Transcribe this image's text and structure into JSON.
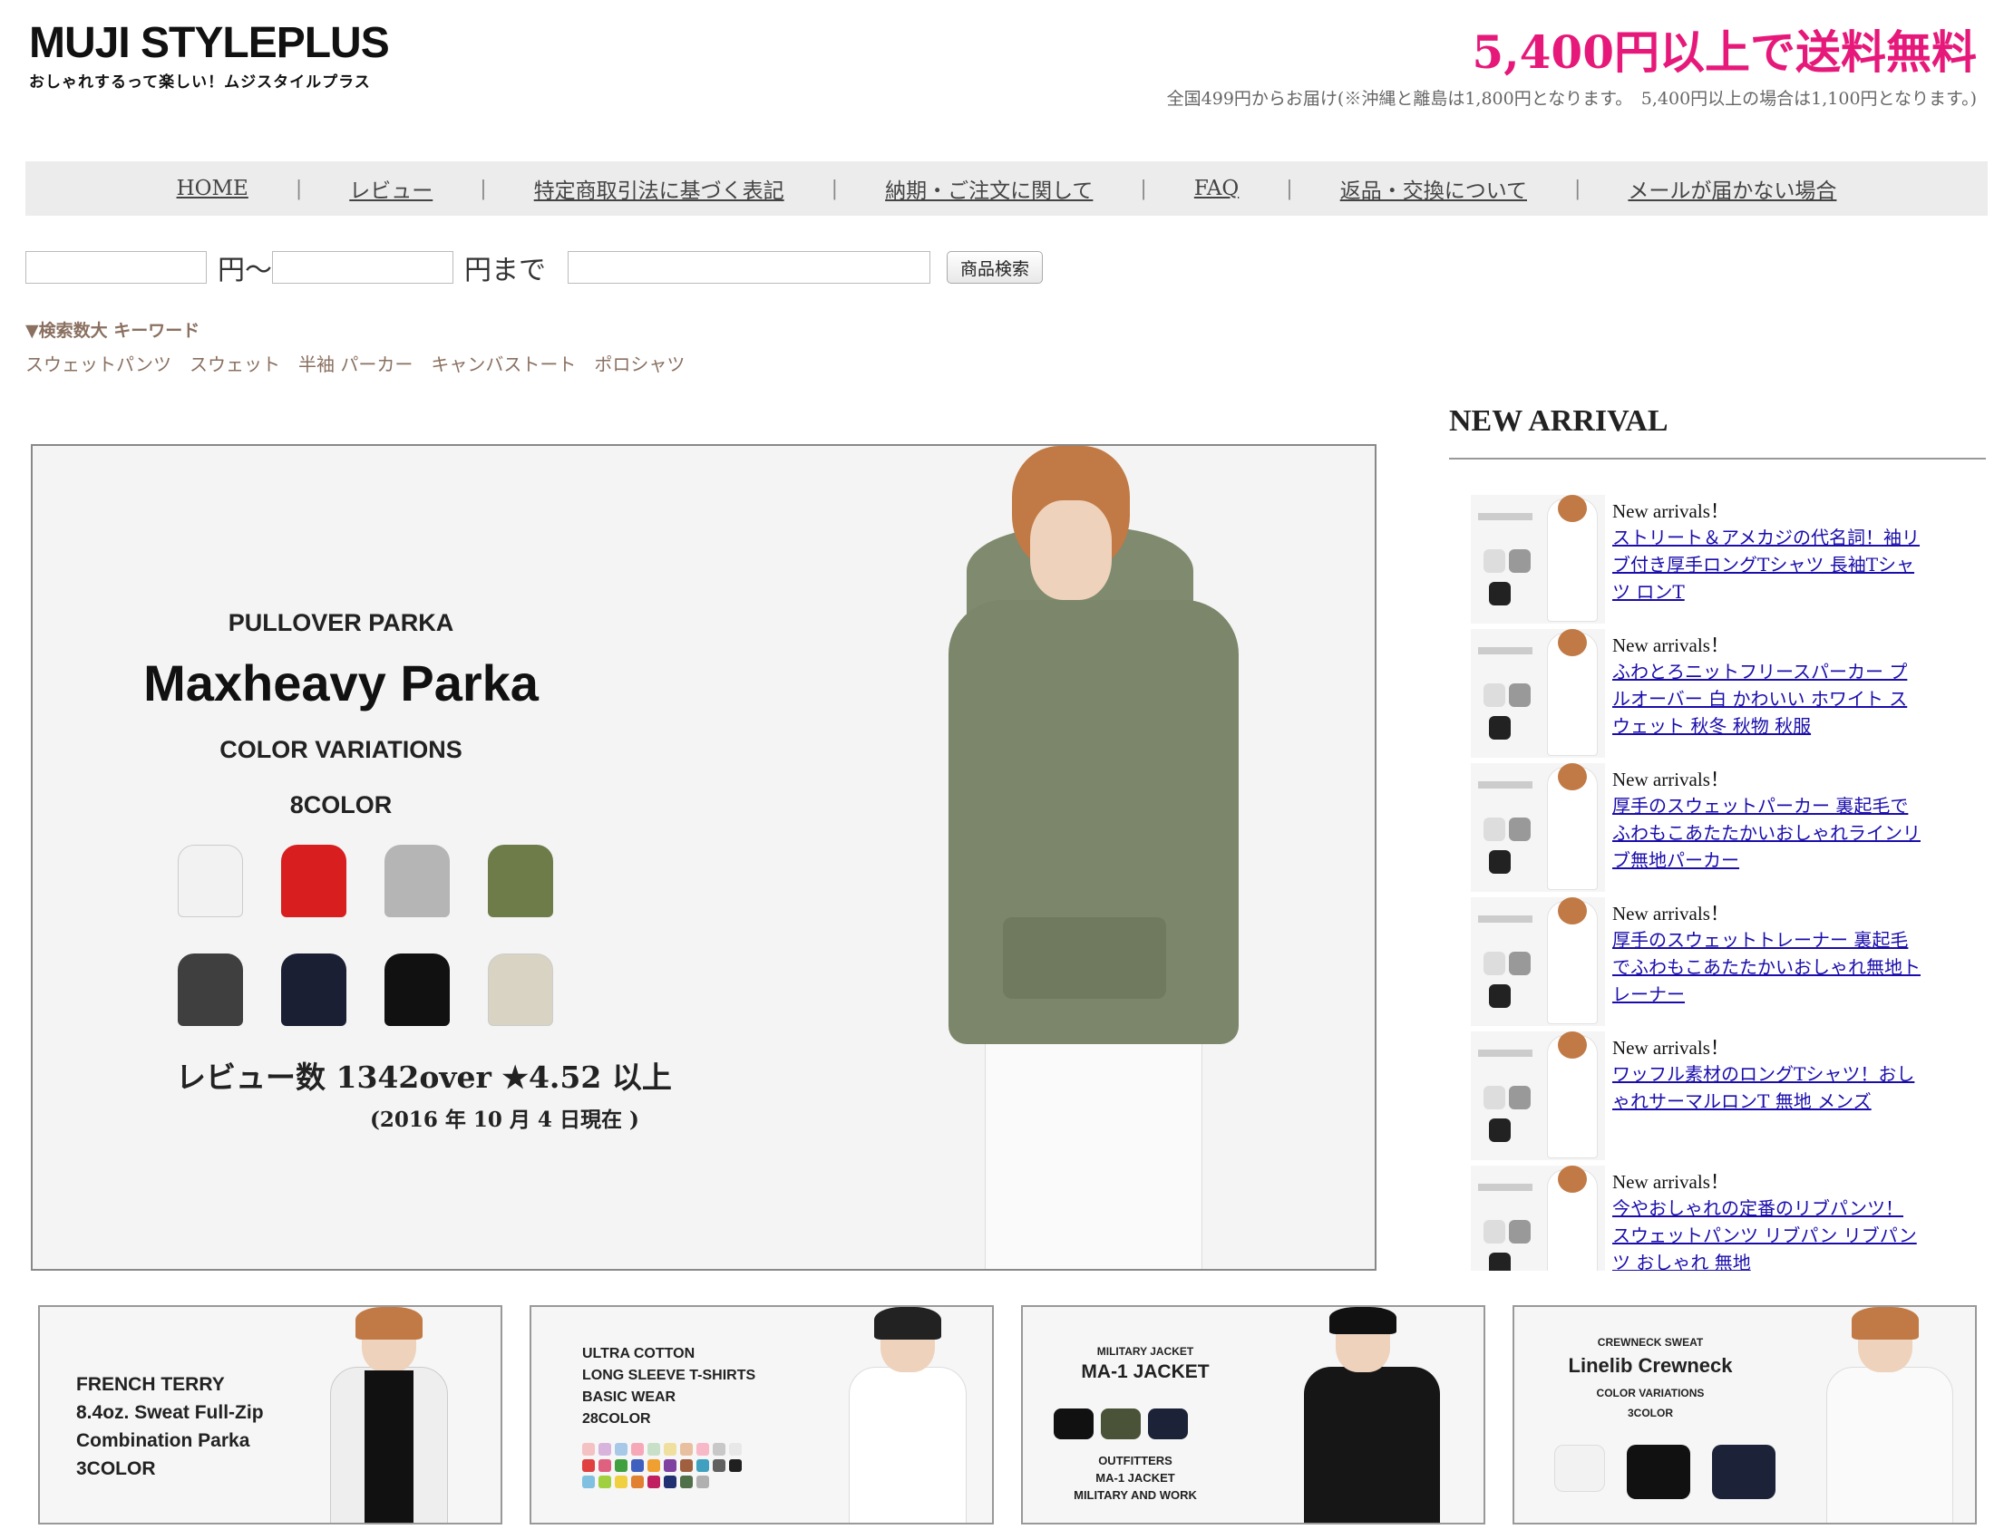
{
  "header": {
    "logo_title": "MUJI STYLEPLUS",
    "logo_tagline": "おしゃれするって楽しい！ムジスタイルプラス",
    "shipping_headline": "5,400円以上で送料無料",
    "shipping_note": "全国499円からお届け(※沖縄と離島は1,800円となります。　5,400円以上の場合は1,100円となります。)"
  },
  "nav": {
    "items": [
      {
        "label": "HOME"
      },
      {
        "label": "レビュー"
      },
      {
        "label": "特定商取引法に基づく表記"
      },
      {
        "label": "納期・ご注文に関して"
      },
      {
        "label": "FAQ"
      },
      {
        "label": "返品・交換について"
      },
      {
        "label": "メールが届かない場合"
      }
    ],
    "separator": "|"
  },
  "search": {
    "min_price_value": "",
    "from_label": "円〜",
    "max_price_value": "",
    "to_label": "円まで",
    "keyword_value": "",
    "button_label": "商品検索"
  },
  "keywords": {
    "title": "▼検索数大 キーワード",
    "items": [
      "スウェットパンツ",
      "スウェット",
      "半袖 パーカー",
      "キャンバストート",
      "ポロシャツ"
    ]
  },
  "hero": {
    "subtitle": "PULLOVER PARKA",
    "title": "Maxheavy Parka",
    "color_variations": "COLOR VARIATIONS",
    "color_count": "8COLOR",
    "swatch_colors": [
      "#f2f2f2",
      "#d81e1e",
      "#b5b5b5",
      "#6e7c4a",
      "#3f3f3f",
      "#1a1f33",
      "#111111",
      "#d9d3c4"
    ],
    "review_text": "レビュー数 1342over ★4.52 以上",
    "date_note": "(2016 年 10 月 4 日現在 )"
  },
  "new_arrival": {
    "title": "NEW ARRIVAL",
    "items": [
      {
        "badge": "New arrivals！",
        "link": "ストリート＆アメカジの代名詞！袖リブ付き厚手ロングTシャツ 長袖Tシャツ ロンT"
      },
      {
        "badge": "New arrivals！",
        "link": "ふわとろニットフリースパーカー プルオーバー 白 かわいい ホワイト スウェット 秋冬 秋物 秋服"
      },
      {
        "badge": "New arrivals！",
        "link": "厚手のスウェットパーカー 裏起毛でふわもこあたたかいおしゃれラインリブ無地パーカー"
      },
      {
        "badge": "New arrivals！",
        "link": "厚手のスウェットトレーナー 裏起毛でふわもこあたたかいおしゃれ無地トレーナー"
      },
      {
        "badge": "New arrivals！",
        "link": "ワッフル素材のロングTシャツ！おしゃれサーマルロンT 無地 メンズ"
      },
      {
        "badge": "New arrivals！",
        "link": "今やおしゃれの定番のリブパンツ！スウェットパンツ リブパン リブパンツ おしゃれ 無地"
      }
    ]
  },
  "banners": [
    {
      "line1": "FRENCH TERRY",
      "line2": "8.4oz. Sweat Full-Zip",
      "line3": "Combination Parka",
      "line4": "3COLOR"
    },
    {
      "line1": "ULTRA COTTON",
      "line2": "LONG SLEEVE T-SHIRTS",
      "line3": "BASIC WEAR",
      "line4": "28COLOR"
    },
    {
      "line1": "MILITARY JACKET",
      "line2": "MA-1 JACKET",
      "line3": "OUTFITTERS",
      "line4": "MA-1 JACKET",
      "line5": "MILITARY AND WORK"
    },
    {
      "line1": "CREWNECK SWEAT",
      "line2": "Linelib Crewneck",
      "line3": "COLOR VARIATIONS",
      "line4": "3COLOR"
    }
  ],
  "colors": {
    "accent_pink": "#e6197a",
    "keyword_brown": "#8a7060",
    "link_blue": "#1a0dab"
  }
}
